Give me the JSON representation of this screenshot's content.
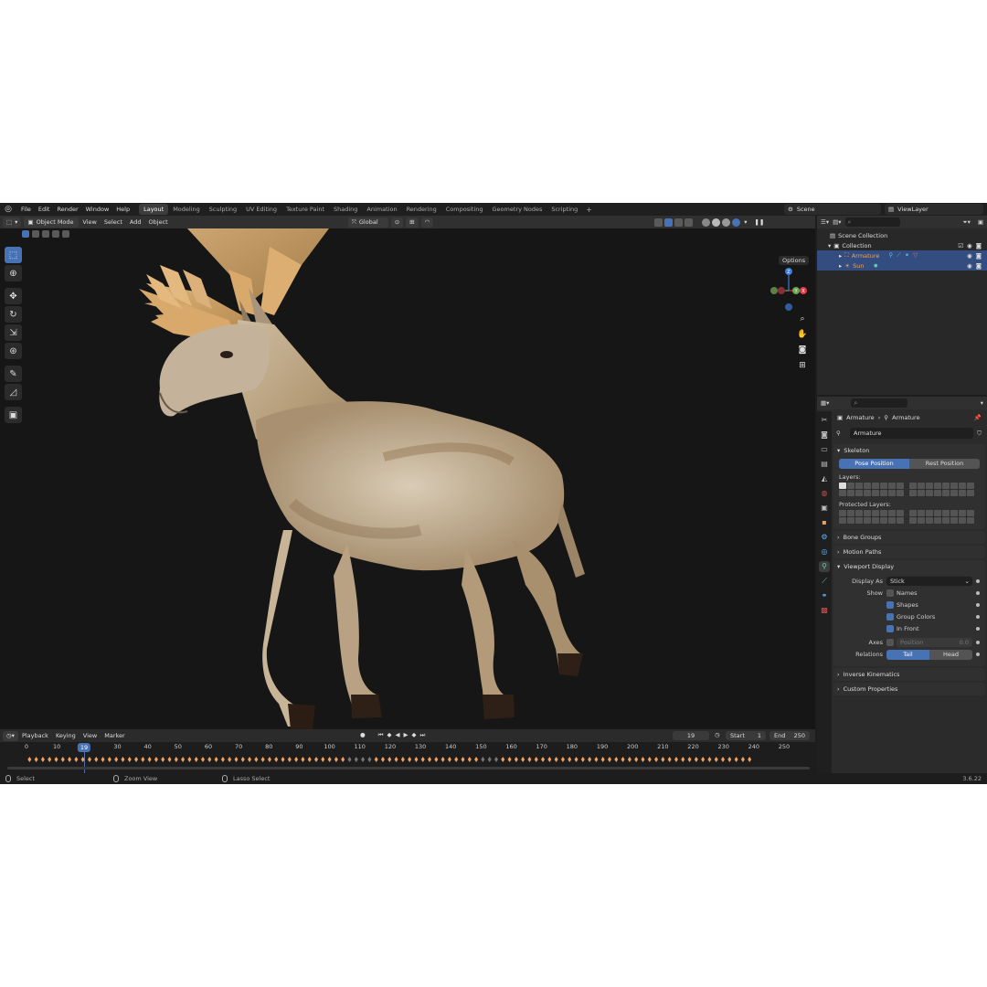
{
  "topbar": {
    "menus": [
      "File",
      "Edit",
      "Render",
      "Window",
      "Help"
    ],
    "workspaces": [
      "Layout",
      "Modeling",
      "Sculpting",
      "UV Editing",
      "Texture Paint",
      "Shading",
      "Animation",
      "Rendering",
      "Compositing",
      "Geometry Nodes",
      "Scripting"
    ],
    "active_workspace": "Layout",
    "scene": "Scene",
    "view_layer": "ViewLayer"
  },
  "viewport_header": {
    "mode": "Object Mode",
    "menus": [
      "View",
      "Select",
      "Add",
      "Object"
    ],
    "orientation": "Global",
    "options": "Options"
  },
  "viewport": {
    "gizmo_axes": [
      "X",
      "Y",
      "Z"
    ],
    "colors": {
      "x": "#e0394a",
      "y": "#6aa84f",
      "z": "#3d7bd8",
      "background": "#161616"
    }
  },
  "timeline": {
    "menus": [
      "Playback",
      "Keying",
      "View",
      "Marker"
    ],
    "current_frame": "19",
    "start_label": "Start",
    "start": "1",
    "end_label": "End",
    "end": "250",
    "ruler": [
      "0",
      "10",
      "30",
      "40",
      "50",
      "60",
      "70",
      "80",
      "90",
      "100",
      "110",
      "120",
      "130",
      "140",
      "150",
      "160",
      "170",
      "180",
      "190",
      "200",
      "210",
      "220",
      "230",
      "240",
      "250"
    ]
  },
  "statusbar": {
    "items": [
      "Select",
      "Zoom View",
      "Lasso Select"
    ],
    "version": "3.6.22"
  },
  "outliner": {
    "rows": [
      {
        "label": "Scene Collection",
        "indent": 0,
        "selected": false
      },
      {
        "label": "Collection",
        "indent": 1,
        "selected": false
      },
      {
        "label": "Armature",
        "indent": 2,
        "selected": true
      },
      {
        "label": "Sun",
        "indent": 2,
        "selected": true
      }
    ]
  },
  "properties": {
    "breadcrumb": [
      "Armature",
      "Armature"
    ],
    "name": "Armature",
    "skeleton": {
      "title": "Skeleton",
      "pose_position": "Pose Position",
      "rest_position": "Rest Position",
      "layers_label": "Layers:",
      "protected_label": "Protected Layers:"
    },
    "collapsed_panels": [
      "Bone Groups",
      "Motion Paths"
    ],
    "viewport_display": {
      "title": "Viewport Display",
      "display_as_label": "Display As",
      "display_as": "Stick",
      "show_label": "Show",
      "names": "Names",
      "shapes": "Shapes",
      "group_colors": "Group Colors",
      "in_front": "In Front",
      "axes_label": "Axes",
      "position_label": "Position",
      "position_value": "0.0",
      "relations_label": "Relations",
      "tail": "Tail",
      "head": "Head"
    },
    "bottom_panels": [
      "Inverse Kinematics",
      "Custom Properties"
    ]
  }
}
